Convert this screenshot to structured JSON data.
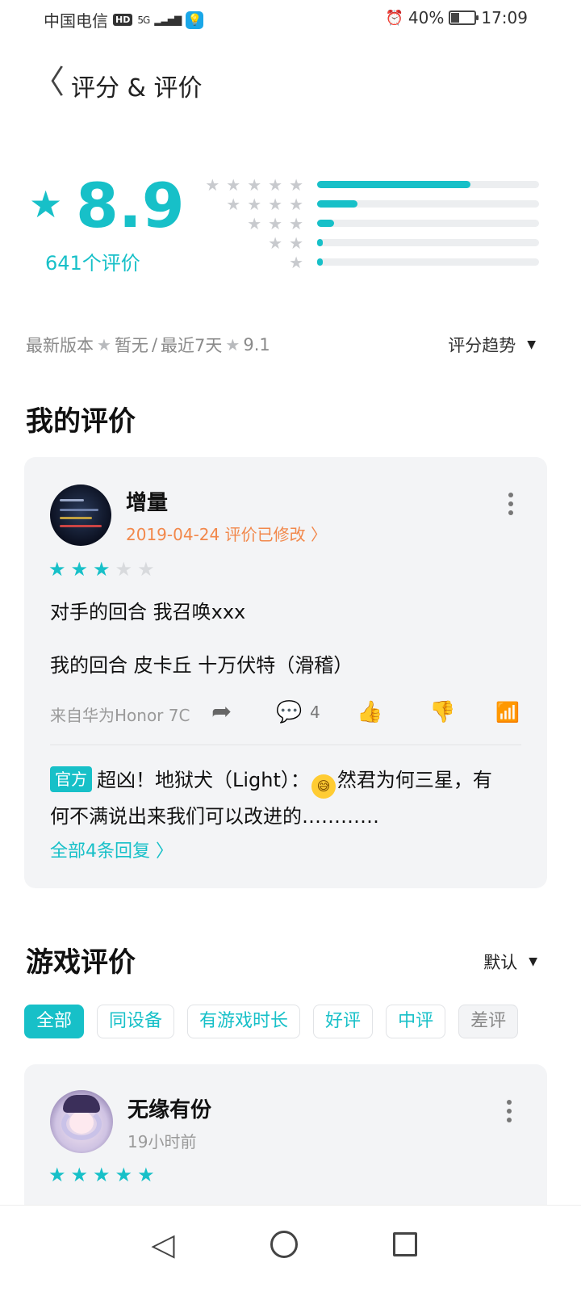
{
  "status_bar": {
    "carrier": "中国电信",
    "hd_badge": "HD",
    "network": "5G",
    "signal_glyph": "▂▃▅▇",
    "bulb_glyph": "💡",
    "alarm_glyph": "⏰",
    "battery_text": "40%",
    "battery_level": 0.4,
    "time": "17:09"
  },
  "header": {
    "back_glyph": "〈",
    "title": "评分 & 评价"
  },
  "rating": {
    "score": "8.9",
    "count_text": "641个评价",
    "star_glyph": "★",
    "distribution": [
      {
        "stars": 5,
        "glyphs": "★★★★★",
        "fraction": 0.69
      },
      {
        "stars": 4,
        "glyphs": "★★★★",
        "fraction": 0.18
      },
      {
        "stars": 3,
        "glyphs": "★★★",
        "fraction": 0.075
      },
      {
        "stars": 2,
        "glyphs": "★★",
        "fraction": 0.025
      },
      {
        "stars": 1,
        "glyphs": "★",
        "fraction": 0.025
      }
    ]
  },
  "version_line": {
    "latest_label": "最新版本",
    "latest_value": "暂无",
    "separator": "/",
    "recent_label": "最近7天",
    "recent_value": "9.1",
    "trend_label": "评分趋势",
    "dropdown_glyph": "▼"
  },
  "my_review": {
    "section_title": "我的评价",
    "user_name": "增量",
    "date_meta": "2019-04-24 评价已修改 〉",
    "rating": 3,
    "star_glyph_on": "★★★",
    "star_glyph_off": "★★",
    "line1": "对手的回合 我召唤xxx",
    "line2": "我的回合 皮卡丘 十万伏特（滑稽）",
    "device": "来自华为Honor 7C",
    "share_glyph": "➦",
    "comment_glyph": "💬",
    "comment_count": "4",
    "like_glyph": "👍",
    "dislike_glyph": "👎",
    "stats_glyph": "📶",
    "reply": {
      "tag": "官方",
      "author_prefix": "超凶！地狱犬（Light）：",
      "emoji_glyph": "😅",
      "text_rest": "然君为何三星，有何不满说出来我们可以改进的…………",
      "all_replies": "全部4条回复 〉"
    }
  },
  "game_reviews": {
    "section_title": "游戏评价",
    "sort_label": "默认",
    "sort_glyph": "▼",
    "filters": [
      "全部",
      "同设备",
      "有游戏时长",
      "好评",
      "中评",
      "差评"
    ],
    "first_review": {
      "user_name": "无缘有份",
      "time_meta": "19小时前",
      "rating": 5,
      "star_glyph_on": "★★★★★"
    }
  },
  "nav_bar": {
    "back_glyph": "◁"
  },
  "colors": {
    "accent": "#17c0c8",
    "orange": "#f2884b",
    "card_bg": "#f3f4f6"
  }
}
